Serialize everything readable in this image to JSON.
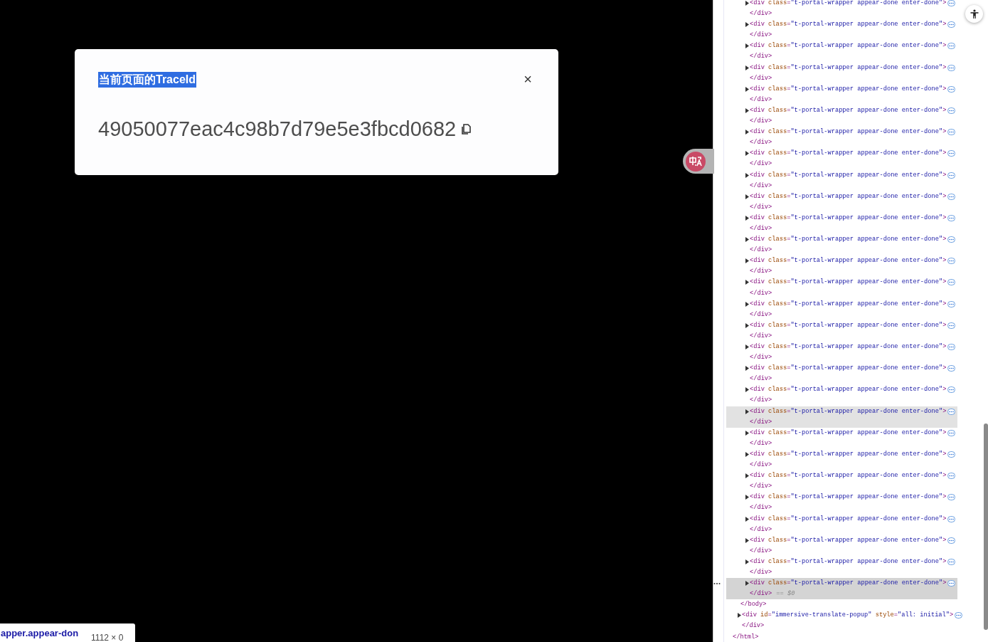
{
  "dialog": {
    "title": "当前页面的TraceId",
    "title_text_selected": true,
    "close": "×",
    "trace_id": "49050077eac4c98b7d79e5e3fbcd0682"
  },
  "devtools": {
    "tree": {
      "close": "</html>",
      "children": [
        {
          "close": "</body>",
          "children": [
            {
              "open": "<div",
              "attrs": [
                {
                  "name": "class",
                  "eq": "=",
                  "value": "\"t-portal-wrapper appear-done enter-done\""
                }
              ],
              "end": ">",
              "close": "</div>",
              "expanded": false,
              "hovered": false,
              "selected": false
            },
            {
              "open": "<div",
              "attrs": [
                {
                  "name": "class",
                  "eq": "=",
                  "value": "\"t-portal-wrapper appear-done enter-done\""
                }
              ],
              "end": ">",
              "close": "</div>",
              "expanded": false,
              "hovered": false,
              "selected": false
            },
            {
              "open": "<div",
              "attrs": [
                {
                  "name": "class",
                  "eq": "=",
                  "value": "\"t-portal-wrapper appear-done enter-done\""
                }
              ],
              "end": ">",
              "close": "</div>",
              "expanded": false,
              "hovered": false,
              "selected": false
            },
            {
              "open": "<div",
              "attrs": [
                {
                  "name": "class",
                  "eq": "=",
                  "value": "\"t-portal-wrapper appear-done enter-done\""
                }
              ],
              "end": ">",
              "close": "</div>",
              "expanded": false,
              "hovered": false,
              "selected": false
            },
            {
              "open": "<div",
              "attrs": [
                {
                  "name": "class",
                  "eq": "=",
                  "value": "\"t-portal-wrapper appear-done enter-done\""
                }
              ],
              "end": ">",
              "close": "</div>",
              "expanded": false,
              "hovered": false,
              "selected": false
            },
            {
              "open": "<div",
              "attrs": [
                {
                  "name": "class",
                  "eq": "=",
                  "value": "\"t-portal-wrapper appear-done enter-done\""
                }
              ],
              "end": ">",
              "close": "</div>",
              "expanded": false,
              "hovered": false,
              "selected": false
            },
            {
              "open": "<div",
              "attrs": [
                {
                  "name": "class",
                  "eq": "=",
                  "value": "\"t-portal-wrapper appear-done enter-done\""
                }
              ],
              "end": ">",
              "close": "</div>",
              "expanded": false,
              "hovered": false,
              "selected": false
            },
            {
              "open": "<div",
              "attrs": [
                {
                  "name": "class",
                  "eq": "=",
                  "value": "\"t-portal-wrapper appear-done enter-done\""
                }
              ],
              "end": ">",
              "close": "</div>",
              "expanded": false,
              "hovered": false,
              "selected": false
            },
            {
              "open": "<div",
              "attrs": [
                {
                  "name": "class",
                  "eq": "=",
                  "value": "\"t-portal-wrapper appear-done enter-done\""
                }
              ],
              "end": ">",
              "close": "</div>",
              "expanded": false,
              "hovered": false,
              "selected": false
            },
            {
              "open": "<div",
              "attrs": [
                {
                  "name": "class",
                  "eq": "=",
                  "value": "\"t-portal-wrapper appear-done enter-done\""
                }
              ],
              "end": ">",
              "close": "</div>",
              "expanded": false,
              "hovered": false,
              "selected": false
            },
            {
              "open": "<div",
              "attrs": [
                {
                  "name": "class",
                  "eq": "=",
                  "value": "\"t-portal-wrapper appear-done enter-done\""
                }
              ],
              "end": ">",
              "close": "</div>",
              "expanded": false,
              "hovered": false,
              "selected": false
            },
            {
              "open": "<div",
              "attrs": [
                {
                  "name": "class",
                  "eq": "=",
                  "value": "\"t-portal-wrapper appear-done enter-done\""
                }
              ],
              "end": ">",
              "close": "</div>",
              "expanded": false,
              "hovered": false,
              "selected": false
            },
            {
              "open": "<div",
              "attrs": [
                {
                  "name": "class",
                  "eq": "=",
                  "value": "\"t-portal-wrapper appear-done enter-done\""
                }
              ],
              "end": ">",
              "close": "</div>",
              "expanded": false,
              "hovered": false,
              "selected": false
            },
            {
              "open": "<div",
              "attrs": [
                {
                  "name": "class",
                  "eq": "=",
                  "value": "\"t-portal-wrapper appear-done enter-done\""
                }
              ],
              "end": ">",
              "close": "</div>",
              "expanded": false,
              "hovered": false,
              "selected": false
            },
            {
              "open": "<div",
              "attrs": [
                {
                  "name": "class",
                  "eq": "=",
                  "value": "\"t-portal-wrapper appear-done enter-done\""
                }
              ],
              "end": ">",
              "close": "</div>",
              "expanded": false,
              "hovered": false,
              "selected": false
            },
            {
              "open": "<div",
              "attrs": [
                {
                  "name": "class",
                  "eq": "=",
                  "value": "\"t-portal-wrapper appear-done enter-done\""
                }
              ],
              "end": ">",
              "close": "</div>",
              "expanded": false,
              "hovered": false,
              "selected": false
            },
            {
              "open": "<div",
              "attrs": [
                {
                  "name": "class",
                  "eq": "=",
                  "value": "\"t-portal-wrapper appear-done enter-done\""
                }
              ],
              "end": ">",
              "close": "</div>",
              "expanded": false,
              "hovered": false,
              "selected": false
            },
            {
              "open": "<div",
              "attrs": [
                {
                  "name": "class",
                  "eq": "=",
                  "value": "\"t-portal-wrapper appear-done enter-done\""
                }
              ],
              "end": ">",
              "close": "</div>",
              "expanded": false,
              "hovered": false,
              "selected": false
            },
            {
              "open": "<div",
              "attrs": [
                {
                  "name": "class",
                  "eq": "=",
                  "value": "\"t-portal-wrapper appear-done enter-done\""
                }
              ],
              "end": ">",
              "close": "</div>",
              "expanded": false,
              "hovered": false,
              "selected": false
            },
            {
              "open": "<div",
              "attrs": [
                {
                  "name": "class",
                  "eq": "=",
                  "value": "\"t-portal-wrapper appear-done enter-done\""
                }
              ],
              "end": ">",
              "close": "</div>",
              "expanded": false,
              "hovered": true,
              "selected": false
            },
            {
              "open": "<div",
              "attrs": [
                {
                  "name": "class",
                  "eq": "=",
                  "value": "\"t-portal-wrapper appear-done enter-done\""
                }
              ],
              "end": ">",
              "close": "</div>",
              "expanded": false,
              "hovered": false,
              "selected": false
            },
            {
              "open": "<div",
              "attrs": [
                {
                  "name": "class",
                  "eq": "=",
                  "value": "\"t-portal-wrapper appear-done enter-done\""
                }
              ],
              "end": ">",
              "close": "</div>",
              "expanded": false,
              "hovered": false,
              "selected": false
            },
            {
              "open": "<div",
              "attrs": [
                {
                  "name": "class",
                  "eq": "=",
                  "value": "\"t-portal-wrapper appear-done enter-done\""
                }
              ],
              "end": ">",
              "close": "</div>",
              "expanded": false,
              "hovered": false,
              "selected": false
            },
            {
              "open": "<div",
              "attrs": [
                {
                  "name": "class",
                  "eq": "=",
                  "value": "\"t-portal-wrapper appear-done enter-done\""
                }
              ],
              "end": ">",
              "close": "</div>",
              "expanded": false,
              "hovered": false,
              "selected": false
            },
            {
              "open": "<div",
              "attrs": [
                {
                  "name": "class",
                  "eq": "=",
                  "value": "\"t-portal-wrapper appear-done enter-done\""
                }
              ],
              "end": ">",
              "close": "</div>",
              "expanded": false,
              "hovered": false,
              "selected": false
            },
            {
              "open": "<div",
              "attrs": [
                {
                  "name": "class",
                  "eq": "=",
                  "value": "\"t-portal-wrapper appear-done enter-done\""
                }
              ],
              "end": ">",
              "close": "</div>",
              "expanded": false,
              "hovered": false,
              "selected": false
            },
            {
              "open": "<div",
              "attrs": [
                {
                  "name": "class",
                  "eq": "=",
                  "value": "\"t-portal-wrapper appear-done enter-done\""
                }
              ],
              "end": ">",
              "close": "</div>",
              "expanded": false,
              "hovered": false,
              "selected": false
            },
            {
              "open": "<div",
              "attrs": [
                {
                  "name": "class",
                  "eq": "=",
                  "value": "\"t-portal-wrapper appear-done enter-done\""
                }
              ],
              "end": ">",
              "close": "</div>",
              "note": "== $0",
              "expanded": false,
              "hovered": false,
              "selected": true
            }
          ]
        },
        {
          "open": "<div",
          "attrs": [
            {
              "name": "id",
              "eq": "=",
              "value": "\"immersive-translate-popup\""
            },
            {
              "name": "style",
              "eq": "=",
              "value": "\"all: initial\""
            }
          ],
          "end": ">",
          "close": "</div>",
          "expanded": false,
          "hovered": false,
          "selected": false
        }
      ]
    }
  },
  "inspect_tooltip": {
    "selector": "apper.appear-don",
    "size": "1112 × 0"
  }
}
